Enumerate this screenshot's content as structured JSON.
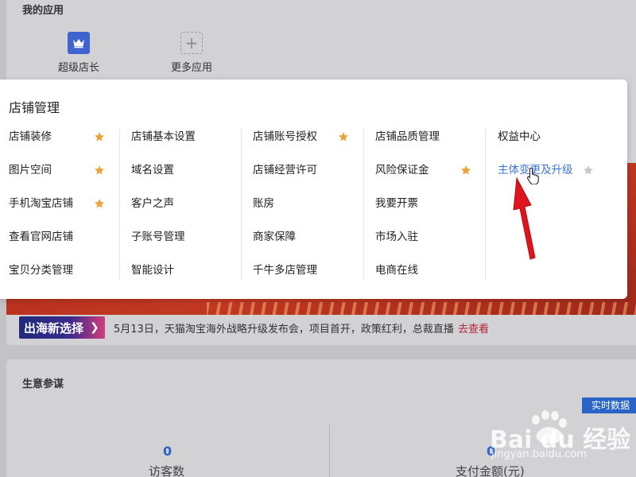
{
  "my_apps": {
    "title": "我的应用",
    "items": [
      {
        "label": "超级店长",
        "icon": "crown-icon"
      },
      {
        "label": "更多应用",
        "icon": "plus-icon"
      }
    ]
  },
  "announcement": {
    "badge": "出海新选择",
    "text": "5月13日，天猫淘宝海外战略升级发布会，项目首开，政策红利，总裁直播",
    "link": "去查看"
  },
  "business": {
    "title": "生意参谋",
    "realtime_button": "实时数据",
    "metrics": [
      {
        "value": "0",
        "label": "访客数"
      },
      {
        "value": "0",
        "label": "支付金额(元)"
      }
    ]
  },
  "store_menu": {
    "title": "店铺管理",
    "columns": [
      [
        {
          "label": "店铺装修",
          "star": "filled"
        },
        {
          "label": "图片空间",
          "star": "filled"
        },
        {
          "label": "手机淘宝店铺",
          "star": "filled"
        },
        {
          "label": "查看官网店铺",
          "star": "none"
        },
        {
          "label": "宝贝分类管理",
          "star": "none"
        }
      ],
      [
        {
          "label": "店铺基本设置",
          "star": "none"
        },
        {
          "label": "域名设置",
          "star": "none"
        },
        {
          "label": "客户之声",
          "star": "none"
        },
        {
          "label": "子账号管理",
          "star": "none"
        },
        {
          "label": "智能设计",
          "star": "none"
        }
      ],
      [
        {
          "label": "店铺账号授权",
          "star": "filled"
        },
        {
          "label": "店铺经营许可",
          "star": "none"
        },
        {
          "label": "账房",
          "star": "none"
        },
        {
          "label": "商家保障",
          "star": "none"
        },
        {
          "label": "千牛多店管理",
          "star": "none"
        }
      ],
      [
        {
          "label": "店铺品质管理",
          "star": "none"
        },
        {
          "label": "风险保证金",
          "star": "filled"
        },
        {
          "label": "我要开票",
          "star": "none"
        },
        {
          "label": "市场入驻",
          "star": "none"
        },
        {
          "label": "电商在线",
          "star": "none"
        }
      ],
      [
        {
          "label": "权益中心",
          "star": "none"
        },
        {
          "label": "主体变更及升级",
          "star": "outline",
          "active": true
        }
      ]
    ]
  },
  "colors": {
    "star_filled": "#f0a23a",
    "star_outline": "#c8c8c8",
    "link_active": "#3d76d0",
    "arrow": "#e0141c"
  },
  "watermark": {
    "brand": "Bai du 经验",
    "url": "jingyan.baidu.com"
  }
}
